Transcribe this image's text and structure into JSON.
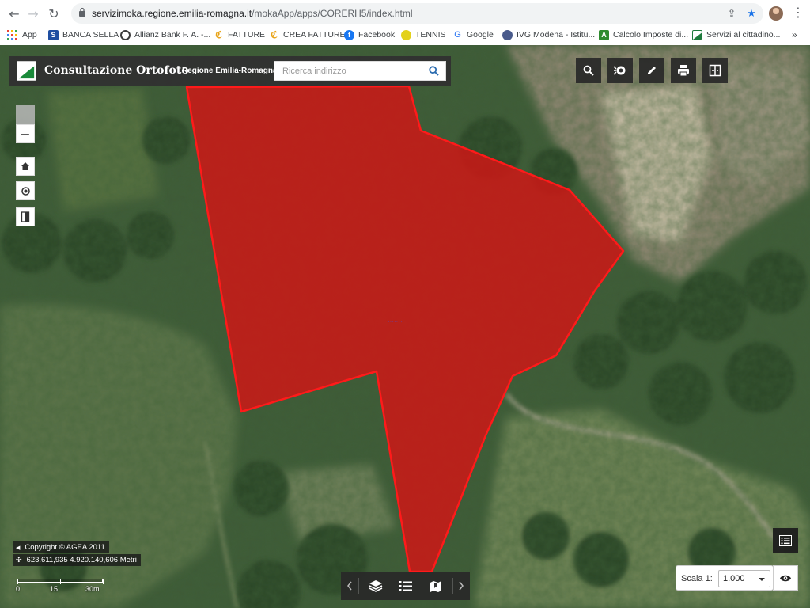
{
  "browser": {
    "url_domain": "servizimoka.regione.emilia-romagna.it",
    "url_path": "/mokaApp/apps/CORERH5/index.html",
    "bookmarks": [
      {
        "label": "App",
        "icon": "apps-grid-icon"
      },
      {
        "label": "BANCA SELLA",
        "icon": "banca-sella-favicon",
        "color": "#1f4ea1",
        "glyph": "S"
      },
      {
        "label": "Allianz Bank F. A. -...",
        "icon": "allianz-favicon",
        "color": "#3d3d3d"
      },
      {
        "label": "FATTURE",
        "icon": "fatture-favicon",
        "color": "#e8a317"
      },
      {
        "label": "CREA FATTURE",
        "icon": "crea-fatture-favicon",
        "color": "#e8a317"
      },
      {
        "label": "Facebook",
        "icon": "facebook-favicon",
        "color": "#1877f2",
        "glyph": "f"
      },
      {
        "label": "TENNIS",
        "icon": "tennis-favicon",
        "color": "#e3d11b"
      },
      {
        "label": "Google",
        "icon": "google-favicon",
        "color": "#4285f4",
        "glyph": "G"
      },
      {
        "label": "IVG Modena - Istitu...",
        "icon": "ivg-favicon",
        "color": "#4a5b8c"
      },
      {
        "label": "Calcolo Imposte di...",
        "icon": "calcolo-favicon",
        "color": "#2e8b2e",
        "glyph": "A"
      },
      {
        "label": "Servizi al cittadino...",
        "icon": "servizi-favicon",
        "color": "#1e7a3c"
      }
    ]
  },
  "app": {
    "title": "Consultazione Ortofoto",
    "region": "Regione Emilia-Romagna",
    "search_placeholder": "Ricerca indirizzo",
    "accent": "#1a8a3a"
  },
  "map": {
    "copyright": "Copyright © AGEA 2011",
    "coordinates": "623.611,935 4.920.140,606 Metri",
    "scalebar_labels": [
      "0",
      "15",
      "30m"
    ],
    "scale_label": "Scala 1:",
    "scale_value": "1.000",
    "polygon_color": "#d31515",
    "zoom_out_label": "−"
  }
}
